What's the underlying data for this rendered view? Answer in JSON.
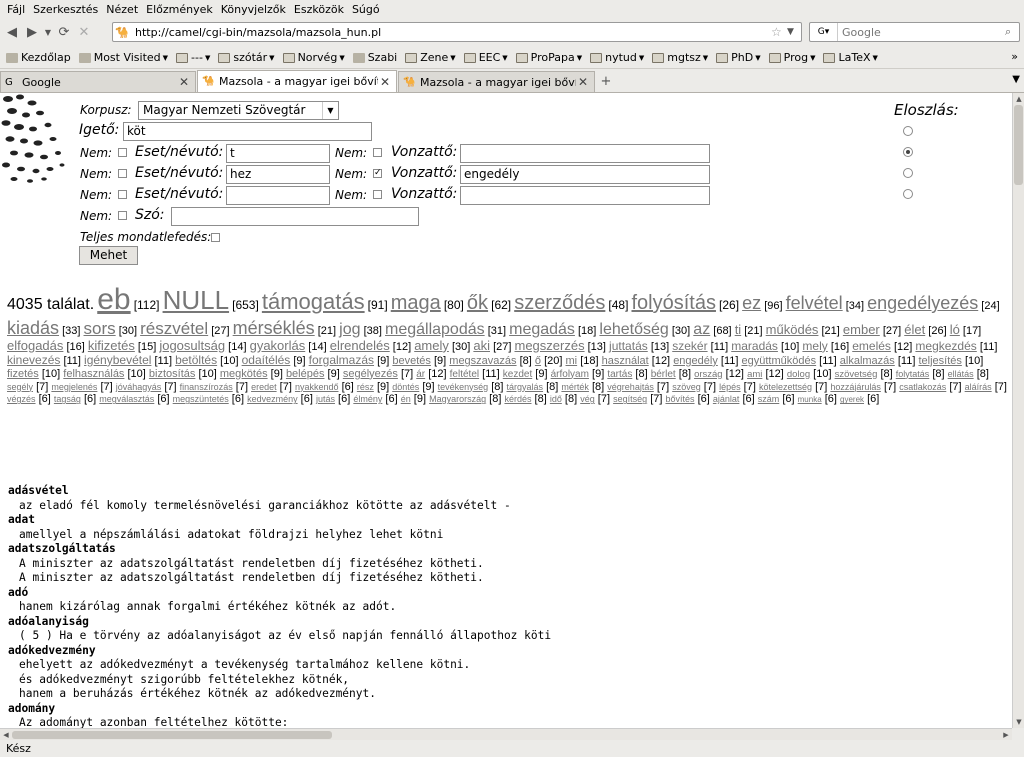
{
  "menubar": [
    "Fájl",
    "Szerkesztés",
    "Nézet",
    "Előzmények",
    "Könyvjelzők",
    "Eszközök",
    "Súgó"
  ],
  "nav": {
    "url": "http://camel/cgi-bin/mazsola/mazsola_hun.pl",
    "search_placeholder": "Google"
  },
  "bookmarks": [
    {
      "label": "Kezdőlap",
      "icon": "page"
    },
    {
      "label": "Most Visited",
      "icon": "page",
      "menu": true
    },
    {
      "label": "---",
      "icon": "folder",
      "menu": true
    },
    {
      "label": "szótár",
      "icon": "folder",
      "menu": true
    },
    {
      "label": "Norvég",
      "icon": "folder",
      "menu": true
    },
    {
      "label": "Szabi",
      "icon": "page"
    },
    {
      "label": "Zene",
      "icon": "folder",
      "menu": true
    },
    {
      "label": "EEC",
      "icon": "folder",
      "menu": true
    },
    {
      "label": "ProPapa",
      "icon": "folder",
      "menu": true
    },
    {
      "label": "nytud",
      "icon": "folder",
      "menu": true
    },
    {
      "label": "mgtsz",
      "icon": "folder",
      "menu": true
    },
    {
      "label": "PhD",
      "icon": "folder",
      "menu": true
    },
    {
      "label": "Prog",
      "icon": "folder",
      "menu": true
    },
    {
      "label": "LaTeX",
      "icon": "folder",
      "menu": true
    }
  ],
  "bookmarks_more": "»",
  "tabs": [
    {
      "label": "Google",
      "active": false
    },
    {
      "label": "Mazsola - a magyar igei bővít...",
      "active": true
    },
    {
      "label": "Mazsola - a magyar igei bővít...",
      "active": false
    }
  ],
  "status": "Kész",
  "form": {
    "corpus_label": "Korpusz:",
    "corpus_value": "Magyar Nemzeti Szövegtár",
    "verb_label": "Igető:",
    "verb_value": "köt",
    "not_label": "Nem:",
    "case_label": "Eset/névutó:",
    "arg_label": "Vonzattő:",
    "word_label": "Szó:",
    "full_cover_label": "Teljes mondatlefedés:",
    "dist_label": "Eloszlás:",
    "submit_label": "Mehet",
    "rows": [
      {
        "case_not": false,
        "case": "t",
        "arg_not": false,
        "arg": ""
      },
      {
        "case_not": false,
        "case": "hez",
        "arg_not": true,
        "arg": "engedély"
      },
      {
        "case_not": false,
        "case": "",
        "arg_not": false,
        "arg": ""
      }
    ],
    "word_value": "",
    "dist_selected": 1
  },
  "cloud": {
    "total": "4035 találat.",
    "items": [
      [
        "eb",
        112,
        30
      ],
      [
        "NULL",
        653,
        26
      ],
      [
        "támogatás",
        91,
        22
      ],
      [
        "maga",
        80,
        20
      ],
      [
        "ők",
        62,
        20
      ],
      [
        "szerződés",
        48,
        20
      ],
      [
        "folyósítás",
        26,
        20
      ],
      [
        "ez",
        96,
        18
      ],
      [
        "felvétel",
        34,
        18
      ],
      [
        "engedélyezés",
        24,
        18
      ],
      [
        "kiadás",
        33,
        18
      ],
      [
        "sors",
        30,
        17
      ],
      [
        "részvétel",
        27,
        17
      ],
      [
        "mérséklés",
        21,
        18
      ],
      [
        "jog",
        38,
        16
      ],
      [
        "megállapodás",
        31,
        16
      ],
      [
        "megadás",
        18,
        16
      ],
      [
        "lehetőség",
        30,
        16
      ],
      [
        "az",
        68,
        16
      ],
      [
        "ti",
        21,
        13
      ],
      [
        "működés",
        21,
        13
      ],
      [
        "ember",
        27,
        13
      ],
      [
        "élet",
        26,
        13
      ],
      [
        "ló",
        17,
        13
      ],
      [
        "elfogadás",
        16,
        13
      ],
      [
        "kifizetés",
        15,
        13
      ],
      [
        "jogosultság",
        14,
        13
      ],
      [
        "gyakorlás",
        14,
        13
      ],
      [
        "elrendelés",
        12,
        13
      ],
      [
        "amely",
        30,
        13
      ],
      [
        "aki",
        27,
        13
      ],
      [
        "megszerzés",
        13,
        13
      ],
      [
        "juttatás",
        13,
        12
      ],
      [
        "szekér",
        11,
        12
      ],
      [
        "maradás",
        10,
        12
      ],
      [
        "mely",
        16,
        12
      ],
      [
        "emelés",
        12,
        12
      ],
      [
        "megkezdés",
        11,
        12
      ],
      [
        "kinevezés",
        11,
        12
      ],
      [
        "igénybevétel",
        11,
        12
      ],
      [
        "betöltés",
        10,
        12
      ],
      [
        "odaítélés",
        9,
        12
      ],
      [
        "forgalmazás",
        9,
        12
      ],
      [
        "bevetés",
        9,
        11
      ],
      [
        "megszavazás",
        8,
        11
      ],
      [
        "ő",
        20,
        11
      ],
      [
        "mi",
        18,
        11
      ],
      [
        "használat",
        12,
        11
      ],
      [
        "engedély",
        11,
        11
      ],
      [
        "együttműködés",
        11,
        11
      ],
      [
        "alkalmazás",
        11,
        11
      ],
      [
        "teljesítés",
        10,
        11
      ],
      [
        "fizetés",
        10,
        11
      ],
      [
        "felhasználás",
        10,
        11
      ],
      [
        "biztosítás",
        10,
        11
      ],
      [
        "megkötés",
        9,
        11
      ],
      [
        "belépés",
        9,
        11
      ],
      [
        "segélyezés",
        7,
        11
      ],
      [
        "ár",
        12,
        10
      ],
      [
        "feltétel",
        11,
        10
      ],
      [
        "kezdet",
        9,
        10
      ],
      [
        "árfolyam",
        9,
        10
      ],
      [
        "tartás",
        8,
        10
      ],
      [
        "bérlet",
        8,
        10
      ],
      [
        "ország",
        12,
        9.5
      ],
      [
        "ami",
        12,
        9.5
      ],
      [
        "dolog",
        10,
        9.5
      ],
      [
        "szövetség",
        8,
        9.5
      ],
      [
        "folytatás",
        8,
        9
      ],
      [
        "ellátás",
        8,
        9
      ],
      [
        "segély",
        7,
        9
      ],
      [
        "megjelenés",
        7,
        9
      ],
      [
        "jóváhagyás",
        7,
        9
      ],
      [
        "finanszírozás",
        7,
        9
      ],
      [
        "eredet",
        7,
        9
      ],
      [
        "nyakkendő",
        6,
        9
      ],
      [
        "rész",
        9,
        9
      ],
      [
        "döntés",
        9,
        9
      ],
      [
        "tevékenység",
        8,
        9
      ],
      [
        "tárgyalás",
        8,
        9
      ],
      [
        "mérték",
        8,
        9
      ],
      [
        "végrehajtás",
        7,
        9
      ],
      [
        "szöveg",
        7,
        9
      ],
      [
        "lépés",
        7,
        9
      ],
      [
        "kötelezettség",
        7,
        9
      ],
      [
        "hozzájárulás",
        7,
        9
      ],
      [
        "csatlakozás",
        7,
        9
      ],
      [
        "aláírás",
        7,
        9
      ],
      [
        "végzés",
        6,
        9
      ],
      [
        "tagság",
        6,
        9
      ],
      [
        "megválasztás",
        6,
        9
      ],
      [
        "megszüntetés",
        6,
        9
      ],
      [
        "kedvezmény",
        6,
        9
      ],
      [
        "jutás",
        6,
        9
      ],
      [
        "élmény",
        6,
        9
      ],
      [
        "én",
        9,
        9
      ],
      [
        "Magyarország",
        8,
        9
      ],
      [
        "kérdés",
        8,
        9
      ],
      [
        "idő",
        8,
        9
      ],
      [
        "vég",
        7,
        9
      ],
      [
        "segítség",
        7,
        9
      ],
      [
        "bővítés",
        6,
        9
      ],
      [
        "ajánlat",
        6,
        9
      ],
      [
        "szám",
        6,
        9
      ],
      [
        "munka",
        6,
        8
      ],
      [
        "gyerek",
        6,
        8
      ]
    ]
  },
  "results": [
    {
      "term": "adásvétel",
      "sentences": [
        "az eladó fél komoly termelésnövelési garanciákhoz kötötte az adásvételt -"
      ]
    },
    {
      "term": "adat",
      "sentences": [
        "amellyel a népszámlálási adatokat földrajzi helyhez lehet kötni"
      ]
    },
    {
      "term": "adatszolgáltatás",
      "sentences": [
        "A miniszter az adatszolgáltatást rendeletben díj fizetéséhez kötheti.",
        "A miniszter az adatszolgáltatást rendeletben díj fizetéséhez kötheti."
      ]
    },
    {
      "term": "adó",
      "sentences": [
        "hanem kizárólag annak forgalmi értékéhez kötnék az adót."
      ]
    },
    {
      "term": "adóalanyiság",
      "sentences": [
        "( 5 ) Ha e törvény az adóalanyiságot az év első napján fennálló állapothoz köti"
      ]
    },
    {
      "term": "adókedvezmény",
      "sentences": [
        "ehelyett az adókedvezményt a tevékenység tartalmához kellene kötni.",
        "és adókedvezményt szigorúbb feltételekhez kötnék,",
        "hanem a beruházás értékéhez kötnék az adókedvezményt."
      ]
    },
    {
      "term": "adomány",
      "sentences": [
        "Az adományt azonban feltételhez kötötte:"
      ]
    }
  ]
}
